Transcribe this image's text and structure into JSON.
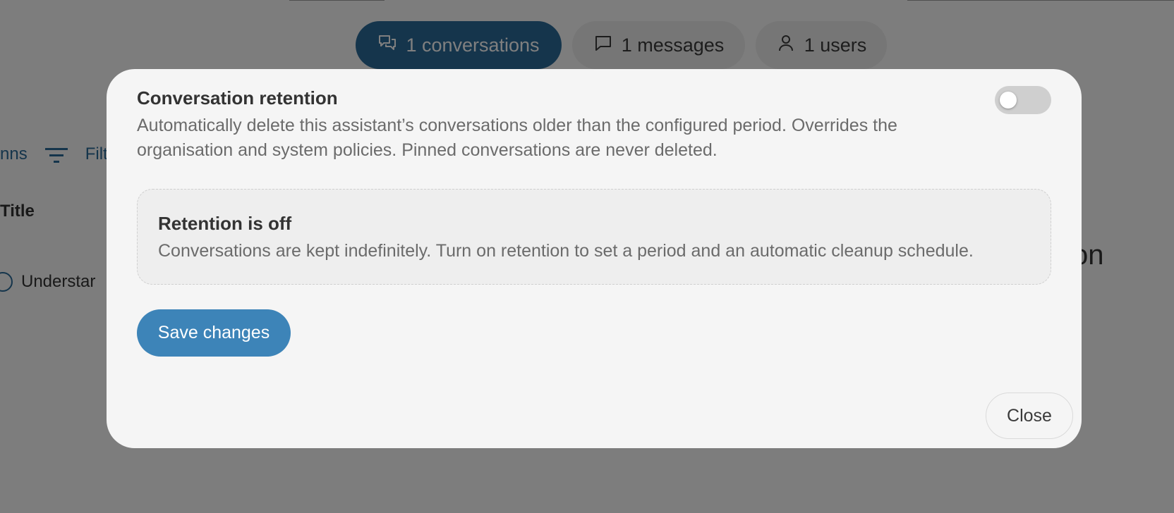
{
  "background": {
    "stats_tabs": [
      {
        "label": "1 conversations",
        "icon": "conversations-icon",
        "active": true
      },
      {
        "label": "1 messages",
        "icon": "message-icon",
        "active": false
      },
      {
        "label": "1 users",
        "icon": "user-icon",
        "active": false
      }
    ],
    "toolbar": {
      "columns_fragment": "nns",
      "filters_fragment": "Filt"
    },
    "table": {
      "title_header_fragment": "Title",
      "row_title_fragment": "Understar"
    },
    "right_fragment": "on"
  },
  "dialog": {
    "heading": "Conversation retention",
    "description": "Automatically delete this assistant’s conversations older than the configured period. Overrides the organisation and system policies. Pinned conversations are never deleted.",
    "toggle_state": "off",
    "status": {
      "title": "Retention is off",
      "text": "Conversations are kept indefinitely. Turn on retention to set a period and an automatic cleanup schedule."
    },
    "save_label": "Save changes",
    "close_label": "Close"
  },
  "colors": {
    "accent": "#3d84b8",
    "active_tab": "#2b6a98",
    "dialog_bg": "#f5f5f5",
    "overlay": "rgba(0,0,0,0.5)"
  }
}
